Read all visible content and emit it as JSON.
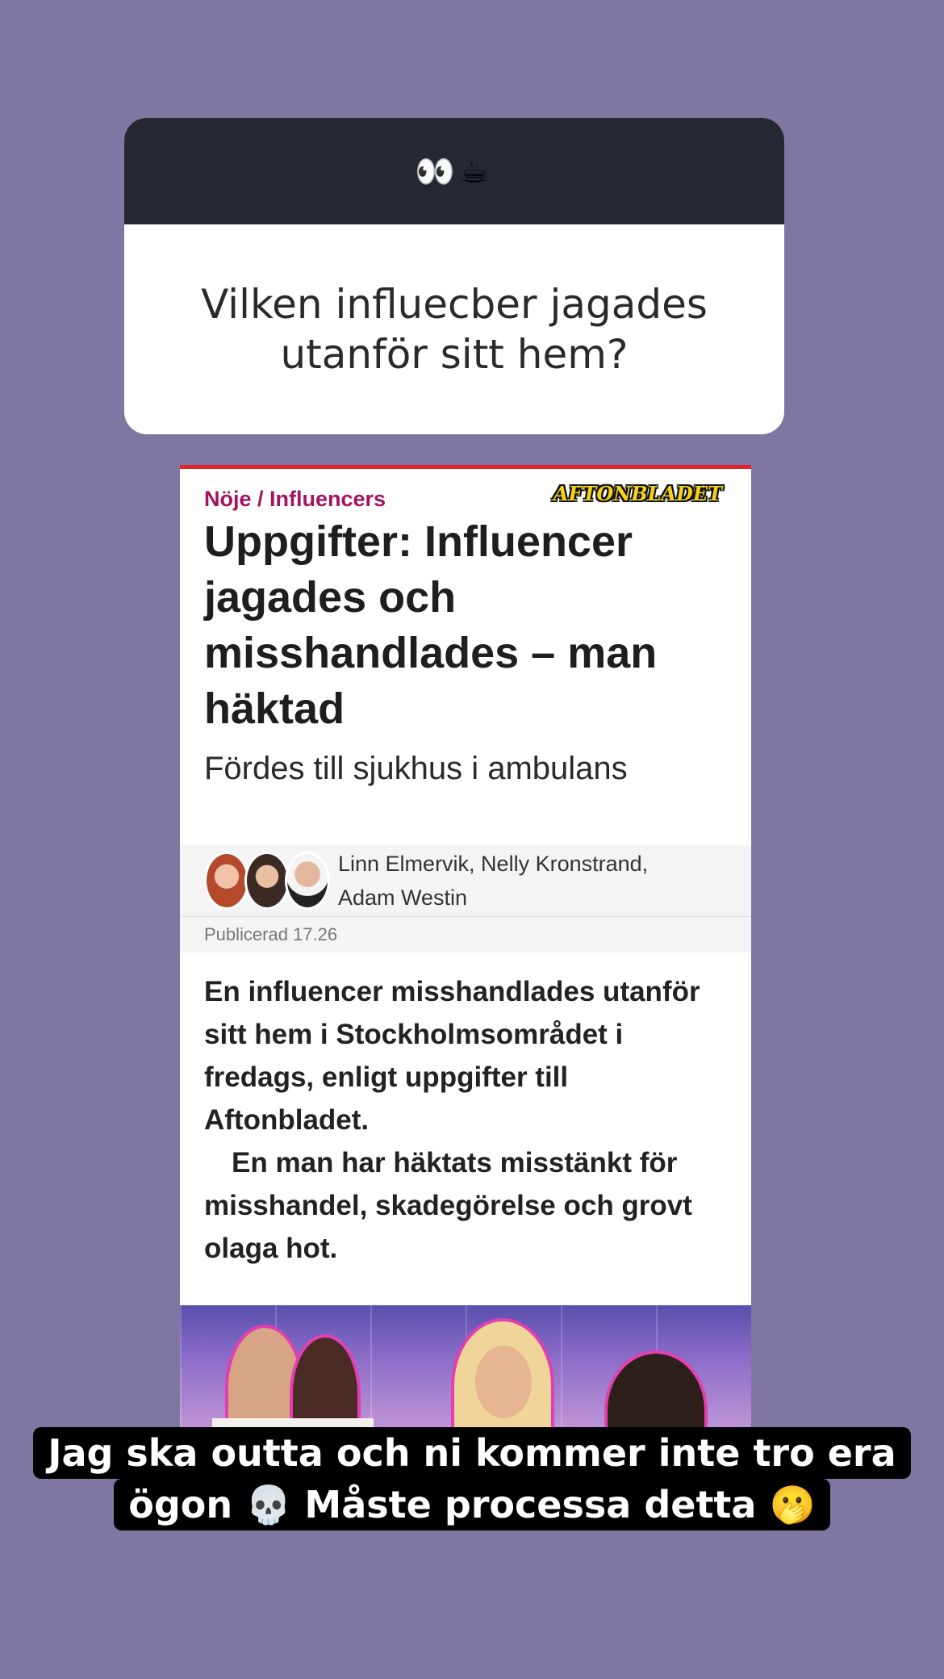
{
  "question_sticker": {
    "header_emoji": "👀☕",
    "question": "Vilken influecber jagades utanför sitt hem?"
  },
  "article": {
    "section": "Nöje / Influencers",
    "brand": "AFTONBLADET",
    "headline": "Uppgifter: Influencer jagades och misshandlades – man häktad",
    "subhead": "Fördes till sjukhus i ambulans",
    "authors_line1": "Linn Elmervik, Nelly Kronstrand,",
    "authors_line2": "Adam Westin",
    "published": "Publicerad 17.26",
    "lead_p1": "En influencer misshandlades utanför sitt hem i Stockholmsområdet i fredags, enligt uppgifter till Aftonbladet.",
    "lead_p2": "En man har häktats misstänkt för misshandel, skadegörelse och grovt olaga hot."
  },
  "caption": {
    "line1": "Jag ska outta och ni kommer inte tro era",
    "line2": "ögon 💀 Måste processa  detta 🫢"
  }
}
